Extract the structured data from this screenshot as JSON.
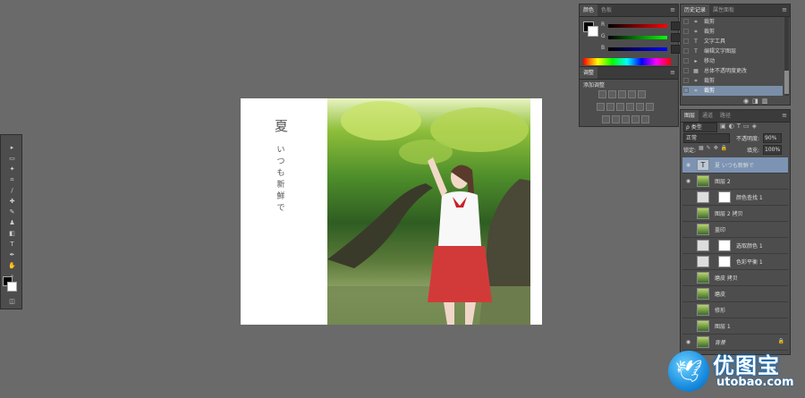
{
  "colors": {
    "canvas_bg": "#6a6a6a",
    "panel_bg": "#4d4d4d",
    "selected": "#7c93b3",
    "watermark_blue": "#1a8de0"
  },
  "color_panel": {
    "tabs": [
      "颜色",
      "色板"
    ],
    "sliders": [
      {
        "label": "R",
        "value": "0"
      },
      {
        "label": "G",
        "value": "0"
      },
      {
        "label": "B",
        "value": "0"
      }
    ]
  },
  "adjustments_panel": {
    "tabs": [
      "调整"
    ],
    "subtitle": "添加调整"
  },
  "history_panel": {
    "tabs": [
      "历史记录",
      "属性面板"
    ],
    "items": [
      {
        "icon": "crop-icon",
        "label": "裁剪"
      },
      {
        "icon": "crop-icon",
        "label": "裁剪"
      },
      {
        "icon": "type-tool-icon",
        "label": "文字工具"
      },
      {
        "icon": "type-tool-icon",
        "label": "编辑文字图层"
      },
      {
        "icon": "move-icon",
        "label": "移动"
      },
      {
        "icon": "history-state-icon",
        "label": "总体不透明度更改"
      },
      {
        "icon": "crop-icon",
        "label": "裁剪"
      },
      {
        "icon": "crop-icon",
        "label": "裁剪",
        "selected": true
      }
    ]
  },
  "layers_panel": {
    "tabs": [
      "图层",
      "通道",
      "路径"
    ],
    "filter_label": "ρ 类型",
    "blend_mode": "正常",
    "opacity_label": "不透明度:",
    "opacity_value": "90%",
    "lock_label": "锁定:",
    "fill_label": "填充:",
    "fill_value": "100%",
    "layers": [
      {
        "name": "夏 いつも新鮮で",
        "type": "text",
        "visible": true,
        "selected": true
      },
      {
        "name": "图层 2",
        "type": "image",
        "visible": true
      },
      {
        "name": "颜色查找 1",
        "type": "adjustment",
        "mask": true
      },
      {
        "name": "图层 2 拷贝",
        "type": "image"
      },
      {
        "name": "盖印",
        "type": "image"
      },
      {
        "name": "选取颜色 1",
        "type": "adjustment",
        "mask": true
      },
      {
        "name": "色彩平衡 1",
        "type": "adjustment",
        "mask": true
      },
      {
        "name": "磨皮 拷贝",
        "type": "image"
      },
      {
        "name": "磨皮",
        "type": "image"
      },
      {
        "name": "修形",
        "type": "image"
      },
      {
        "name": "图层 1",
        "type": "image"
      },
      {
        "name": "背景",
        "type": "image",
        "visible": true,
        "locked": true
      }
    ]
  },
  "document": {
    "title_char": "夏",
    "subtitle_chars": [
      "い",
      "つ",
      "も",
      "新",
      "鮮",
      "で"
    ]
  },
  "watermark": {
    "title": "优图宝",
    "url": "utobao.com"
  }
}
